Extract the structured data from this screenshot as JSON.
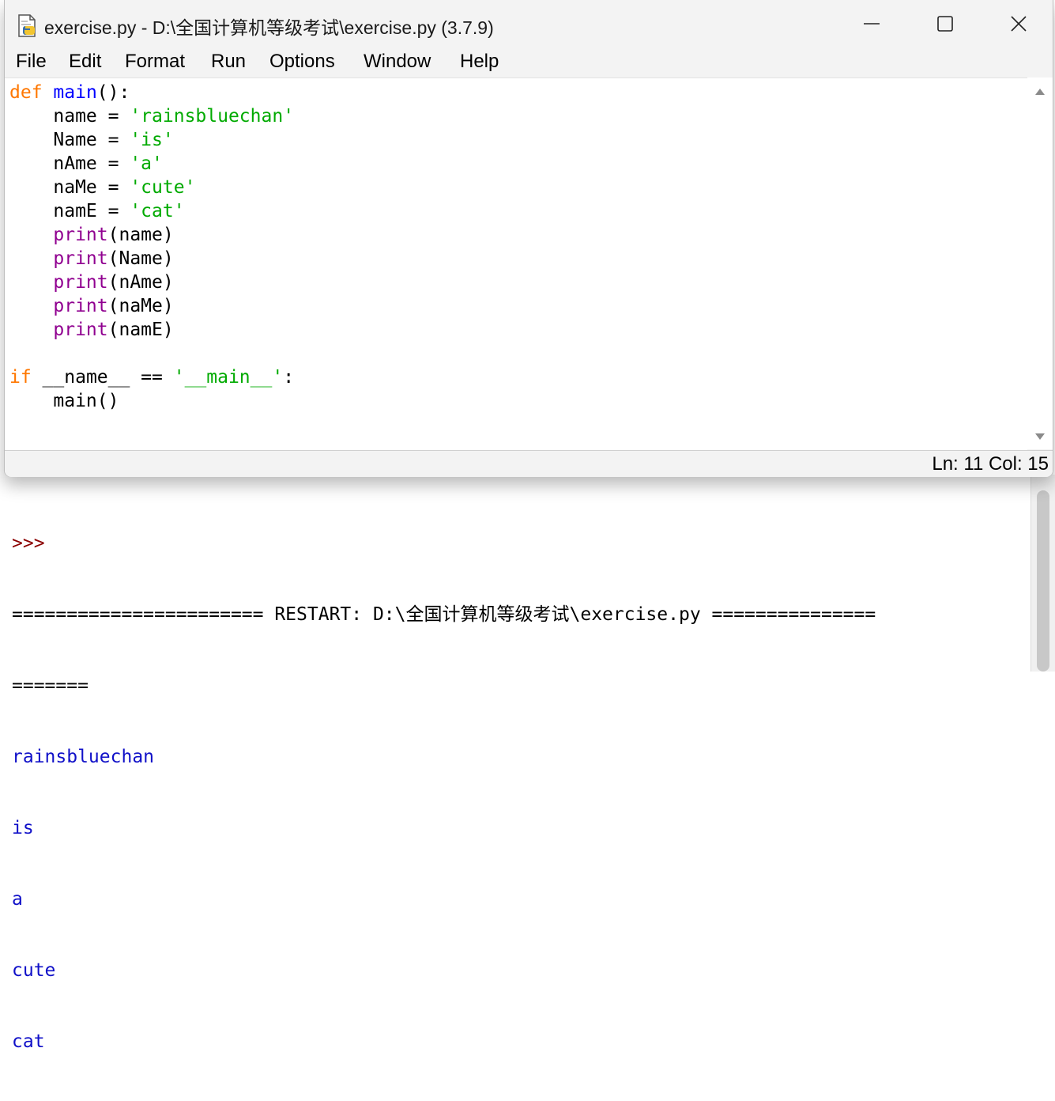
{
  "window": {
    "title": "exercise.py - D:\\全国计算机等级考试\\exercise.py (3.7.9)",
    "minimize_icon": "minimize-icon",
    "maximize_icon": "maximize-icon",
    "close_icon": "close-icon"
  },
  "menu": [
    "File",
    "Edit",
    "Format",
    "Run",
    "Options",
    "Window",
    "Help"
  ],
  "code": {
    "lines": [
      [
        {
          "t": "def",
          "c": "kw"
        },
        {
          "t": " "
        },
        {
          "t": "main",
          "c": "fn"
        },
        {
          "t": "():"
        }
      ],
      [
        {
          "t": "    name = "
        },
        {
          "t": "'rainsbluechan'",
          "c": "str"
        }
      ],
      [
        {
          "t": "    Name = "
        },
        {
          "t": "'is'",
          "c": "str"
        }
      ],
      [
        {
          "t": "    nAme = "
        },
        {
          "t": "'a'",
          "c": "str"
        }
      ],
      [
        {
          "t": "    naMe = "
        },
        {
          "t": "'cute'",
          "c": "str"
        }
      ],
      [
        {
          "t": "    namE = "
        },
        {
          "t": "'cat'",
          "c": "str"
        }
      ],
      [
        {
          "t": "    "
        },
        {
          "t": "print",
          "c": "bi"
        },
        {
          "t": "(name)"
        }
      ],
      [
        {
          "t": "    "
        },
        {
          "t": "print",
          "c": "bi"
        },
        {
          "t": "(Name)"
        }
      ],
      [
        {
          "t": "    "
        },
        {
          "t": "print",
          "c": "bi"
        },
        {
          "t": "(nAme)"
        }
      ],
      [
        {
          "t": "    "
        },
        {
          "t": "print",
          "c": "bi"
        },
        {
          "t": "(naMe)"
        }
      ],
      [
        {
          "t": "    "
        },
        {
          "t": "print",
          "c": "bi"
        },
        {
          "t": "(namE)"
        }
      ],
      [
        {
          "t": ""
        }
      ],
      [
        {
          "t": "if",
          "c": "kw"
        },
        {
          "t": " __name__ == "
        },
        {
          "t": "'__main__'",
          "c": "str"
        },
        {
          "t": ":"
        }
      ],
      [
        {
          "t": "    main()"
        }
      ]
    ]
  },
  "status": {
    "text": "Ln: 11  Col: 15"
  },
  "shell": {
    "prompt": ">>>",
    "restart_line": "======================= RESTART: D:\\全国计算机等级考试\\exercise.py ===============",
    "restart_wrap": "=======",
    "output": [
      "rainsbluechan",
      "is",
      "a",
      "cute",
      "cat"
    ]
  },
  "colors": {
    "keyword": "#ff7700",
    "builtin": "#900090",
    "definition": "#0000ff",
    "string": "#00aa00",
    "shell_output": "#1010c8",
    "prompt": "#8b0000"
  }
}
